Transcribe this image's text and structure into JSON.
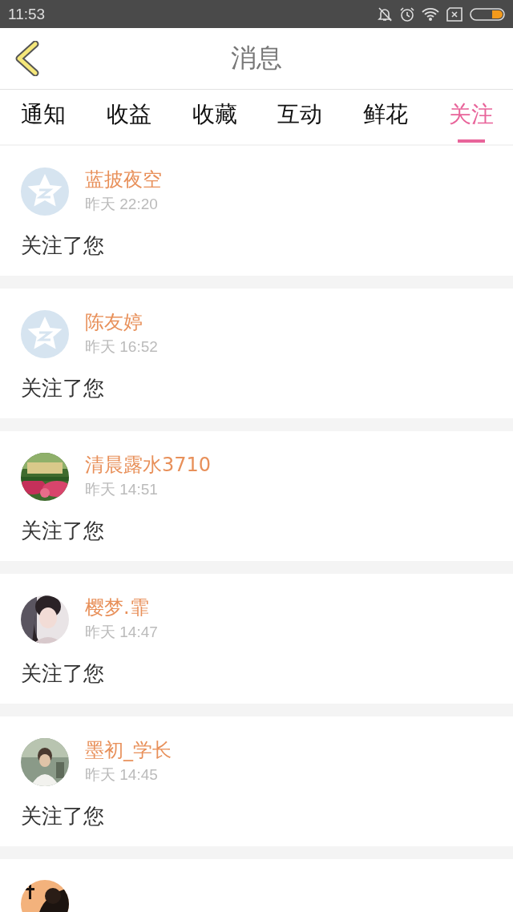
{
  "status_bar": {
    "time": "11:53"
  },
  "header": {
    "title": "消息"
  },
  "tabs": [
    {
      "label": "通知",
      "selected": false
    },
    {
      "label": "收益",
      "selected": false
    },
    {
      "label": "收藏",
      "selected": false
    },
    {
      "label": "互动",
      "selected": false
    },
    {
      "label": "鲜花",
      "selected": false
    },
    {
      "label": "关注",
      "selected": true
    }
  ],
  "messages": [
    {
      "avatar": {
        "kind": "default"
      },
      "name": "蓝披夜空",
      "time": "昨天 22:20",
      "text": "关注了您"
    },
    {
      "avatar": {
        "kind": "default"
      },
      "name": "陈友婷",
      "time": "昨天 16:52",
      "text": "关注了您"
    },
    {
      "avatar": {
        "kind": "picture"
      },
      "name": "清晨露水3710",
      "time": "昨天 14:51",
      "text": "关注了您"
    },
    {
      "avatar": {
        "kind": "picture"
      },
      "name": "樱梦.霏",
      "time": "昨天 14:47",
      "text": "关注了您"
    },
    {
      "avatar": {
        "kind": "picture"
      },
      "name": "墨初_学长",
      "time": "昨天 14:45",
      "text": "关注了您"
    },
    {
      "avatar": {
        "kind": "picture"
      }
    }
  ]
}
